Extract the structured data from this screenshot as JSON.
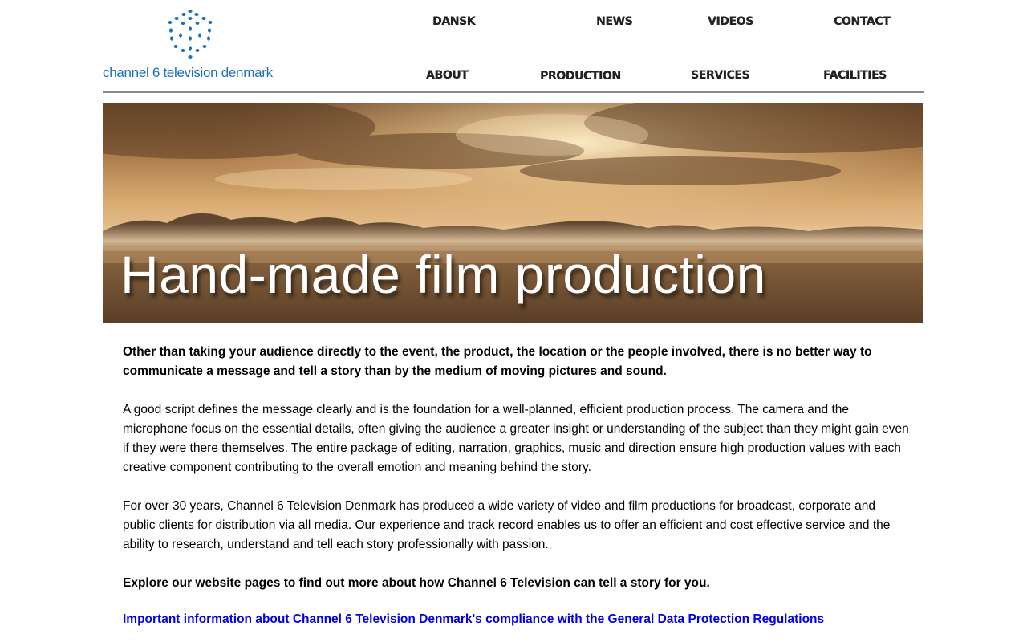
{
  "header": {
    "logo_text": "channel 6 television denmark",
    "logo_color": "#1d6fb8",
    "nav_top": [
      "DANSK",
      "NEWS",
      "VIDEOS",
      "CONTACT"
    ],
    "nav_bottom": [
      "ABOUT",
      "PRODUCTION",
      "SERVICES",
      "FACILITIES"
    ]
  },
  "banner": {
    "title": "Hand-made film production"
  },
  "content": {
    "lead": "Other than taking your audience directly to the event, the product, the location or the people involved, there is no better way to communicate a message and tell a story than by the medium of moving pictures and sound.",
    "paragraph1": "A good script defines the message clearly and is the foundation for a well-planned, efficient production process. The camera and the microphone focus on the essential details, often giving the audience a greater insight or understanding of the subject than they might gain even if they were there themselves. The entire package of editing, narration, graphics, music and direction ensure high production values with each creative component contributing to the overall emotion and meaning behind the story.",
    "paragraph2": "For over 30 years, Channel 6 Television Denmark has produced a wide variety of video and film productions for broadcast, corporate and public clients for distribution via all media. Our experience and track record enables us to offer an efficient and cost effective service and the ability to research, understand and tell each story professionally with passion.",
    "cta": "Explore our website pages to find out more about how Channel 6 Television can tell a story for you.",
    "gdpr_link": "Important information about Channel 6 Television Denmark's compliance with the General Data Protection Regulations"
  },
  "colors": {
    "link": "#0000ee",
    "rule": "#8a8a8a"
  }
}
